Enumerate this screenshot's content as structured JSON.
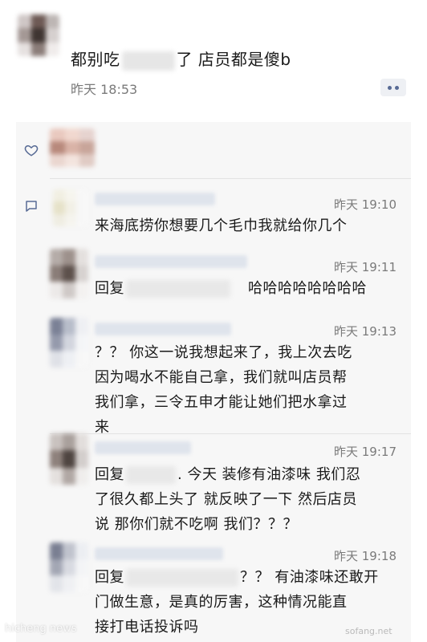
{
  "post": {
    "text_before": "都别吃",
    "text_after": "了 店员都是傻b",
    "time": "昨天 18:53"
  },
  "icons": {
    "like": "heart-outline-icon",
    "comment": "comment-bubble-icon",
    "more": "more-dots-icon"
  },
  "comments": [
    {
      "time": "昨天 19:10",
      "text": "来海底捞你想要几个毛巾我就给你几个"
    },
    {
      "time": "昨天 19:11",
      "prefix": "回复",
      "text": "哈哈哈哈哈哈哈哈"
    },
    {
      "time": "昨天 19:13",
      "lines": [
        "？？ 你这一说我想起来了，我上次去吃",
        "因为喝水不能自己拿，我们就叫店员帮",
        "我们拿，三令五申才能让她们把水拿过",
        "来"
      ]
    },
    {
      "time": "昨天 19:17",
      "prefix": "回复",
      "lines": [
        ". 今天 装修有油漆味 我们忍",
        "了很久都上头了 就反映了一下 然后店员",
        "说 那你们就不吃啊 我们？？？"
      ]
    },
    {
      "time": "昨天 19:18",
      "prefix": "回复",
      "lines": [
        "？？ 有油漆味还敢开",
        "门做生意，是真的厉害，这种情况能直",
        "接打电话投诉吗"
      ]
    }
  ],
  "watermark": {
    "left": "hicheng news",
    "right": "sofang.net"
  },
  "colors": {
    "link_blue": "#586b95",
    "panel_bg": "#f7f7f7",
    "time_gray": "#7a7a7a"
  }
}
